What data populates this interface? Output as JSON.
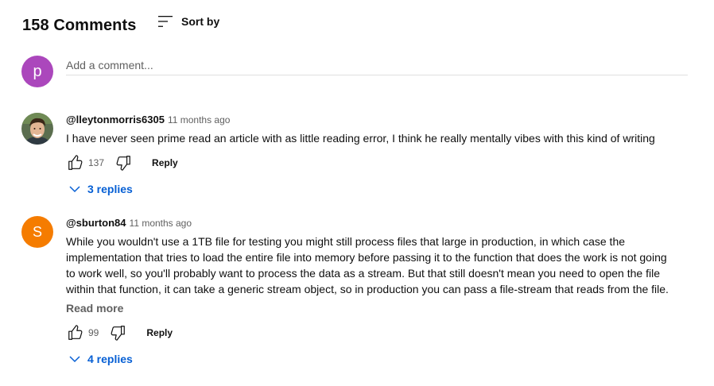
{
  "header": {
    "comment_count": "158 Comments",
    "sort_label": "Sort by"
  },
  "add_comment": {
    "avatar_letter": "p",
    "avatar_color": "#ab47bc",
    "placeholder": "Add a comment..."
  },
  "comments": [
    {
      "author": "@lleytonmorris6305",
      "time": "11 months ago",
      "text": "I have never seen prime read an article with as little reading error, I think he really mentally vibes with this kind of  writing",
      "likes": "137",
      "reply_label": "Reply",
      "replies_label": "3 replies"
    },
    {
      "author": "@sburton84",
      "time": "11 months ago",
      "avatar_letter": "S",
      "avatar_color": "#f57c00",
      "text": "While you wouldn't use a 1TB file for testing you might still process files that large in production, in which case the implementation that tries to load the entire file into memory before passing it to the function that does the work is not going to work well, so you'll probably want to process the data as a stream. But that still doesn't mean you need to open the file within that function, it can take a generic stream object, so in production you can pass a file-stream that reads from the file.",
      "read_more": "Read more",
      "likes": "99",
      "reply_label": "Reply",
      "replies_label": "4 replies"
    }
  ],
  "colors": {
    "link_blue": "#065fd4",
    "secondary_text": "#606060"
  }
}
